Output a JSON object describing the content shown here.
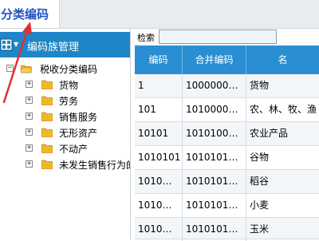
{
  "tab": {
    "label": "分类编码"
  },
  "left_panel": {
    "title": "编码族管理",
    "tree": {
      "root": {
        "label": "税收分类编码",
        "expander": "−"
      },
      "children": [
        {
          "label": "货物",
          "expander": "+"
        },
        {
          "label": "劳务",
          "expander": "+"
        },
        {
          "label": "销售服务",
          "expander": "+"
        },
        {
          "label": "无形资产",
          "expander": "+"
        },
        {
          "label": "不动产",
          "expander": "+"
        },
        {
          "label": "未发生销售行为的",
          "expander": "+"
        }
      ]
    }
  },
  "search": {
    "label": "检索",
    "value": ""
  },
  "table": {
    "headers": [
      "编码",
      "合并编码",
      "名"
    ],
    "rows": [
      [
        "1",
        "1000000…",
        "货物"
      ],
      [
        "101",
        "1010000…",
        "农、林、牧、渔"
      ],
      [
        "10101",
        "1010100…",
        "农业产品"
      ],
      [
        "1010101",
        "1010101…",
        "谷物"
      ],
      [
        "1010…",
        "1010101…",
        "稻谷"
      ],
      [
        "1010…",
        "1010101…",
        "小麦"
      ],
      [
        "1010…",
        "1010101…",
        "玉米"
      ]
    ]
  },
  "colors": {
    "tab_text": "#1f55c6",
    "header_blue": "#1e86c7",
    "grid_header": "#2a8fd2",
    "arrow": "#e03030",
    "folder": "#f2b531"
  }
}
